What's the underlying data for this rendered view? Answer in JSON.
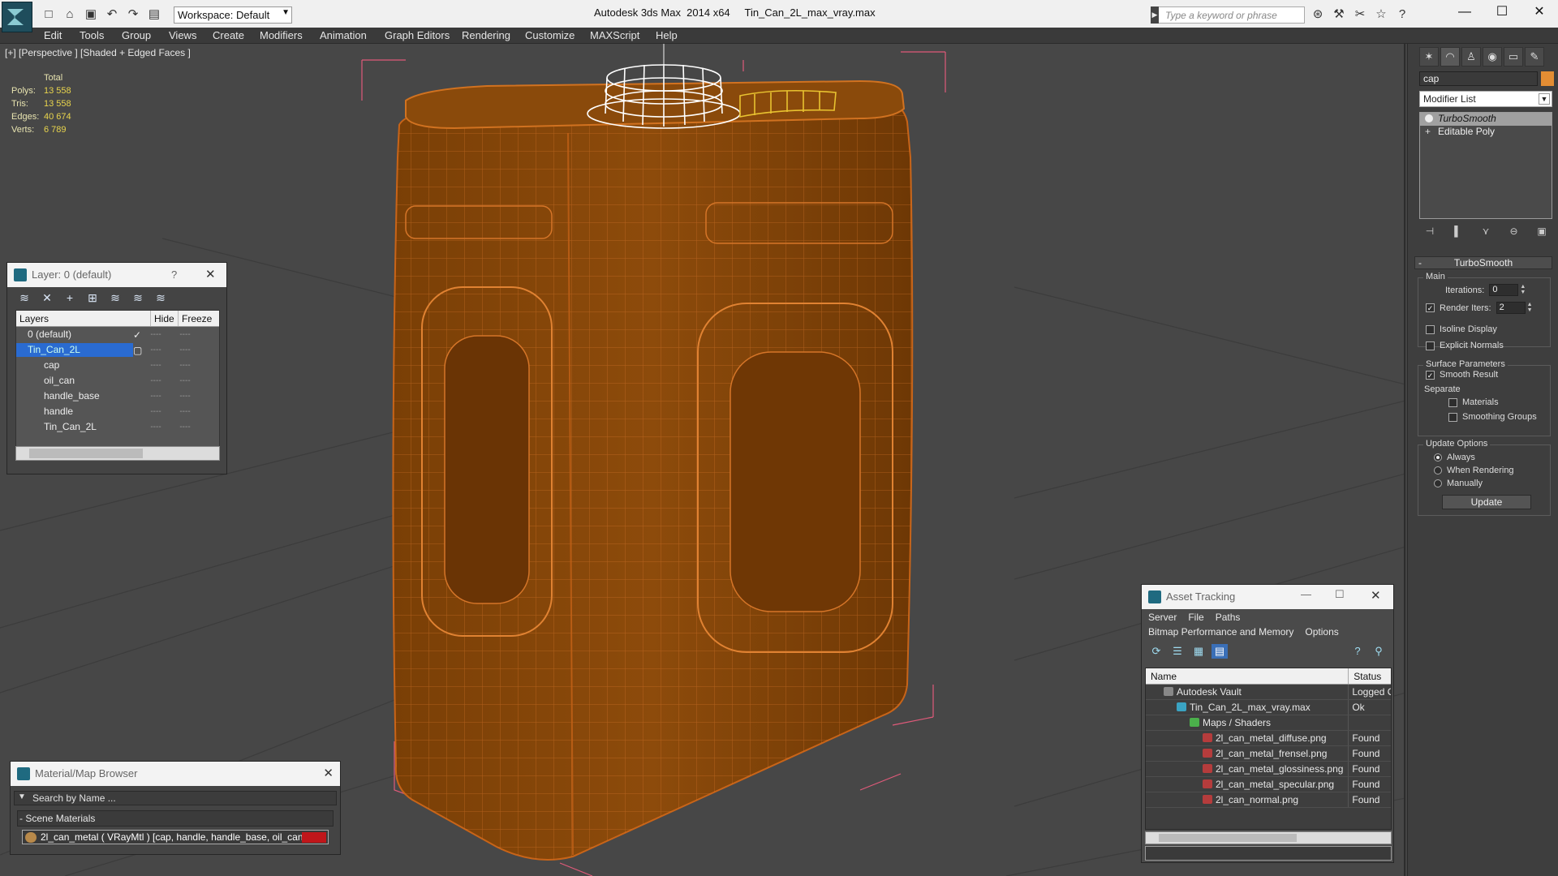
{
  "app": {
    "title": "Autodesk 3ds Max  2014 x64     Tin_Can_2L_max_vray.max",
    "workspace": "Workspace: Default",
    "search_placeholder": "Type a keyword or phrase"
  },
  "menu": [
    "Edit",
    "Tools",
    "Group",
    "Views",
    "Create",
    "Modifiers",
    "Animation",
    "Graph Editors",
    "Rendering",
    "Customize",
    "MAXScript",
    "Help"
  ],
  "viewport": {
    "label": "[+] [Perspective ] [Shaded + Edged Faces ]",
    "stats": {
      "total_label": "Total",
      "rows": [
        {
          "k": "Polys:",
          "v": "13 558"
        },
        {
          "k": "Tris:",
          "v": "13 558"
        },
        {
          "k": "Edges:",
          "v": "40 674"
        },
        {
          "k": "Verts:",
          "v": "6 789"
        }
      ]
    }
  },
  "layers_window": {
    "title": "Layer: 0 (default)",
    "help": "?",
    "columns": {
      "layers": "Layers",
      "hide": "Hide",
      "freeze": "Freeze"
    },
    "rows": [
      {
        "name": "0 (default)",
        "check": "✓"
      },
      {
        "name": "Tin_Can_2L",
        "check": ""
      },
      {
        "name": "cap",
        "check": ""
      },
      {
        "name": "oil_can",
        "check": ""
      },
      {
        "name": "handle_base",
        "check": ""
      },
      {
        "name": "handle",
        "check": ""
      },
      {
        "name": "Tin_Can_2L",
        "check": ""
      }
    ],
    "dash": "----"
  },
  "material_browser": {
    "title": "Material/Map Browser",
    "search_placeholder": "Search by Name ...",
    "group": "Scene Materials",
    "material": "2l_can_metal  ( VRayMtl ) [cap, handle, handle_base, oil_can]"
  },
  "asset_tracking": {
    "title": "Asset Tracking",
    "menu1": [
      "Server",
      "File",
      "Paths"
    ],
    "menu2": [
      "Bitmap Performance and Memory",
      "Options"
    ],
    "columns": {
      "name": "Name",
      "status": "Status"
    },
    "rows": [
      {
        "name": "Autodesk Vault",
        "status": "Logged O",
        "indent": 1
      },
      {
        "name": "Tin_Can_2L_max_vray.max",
        "status": "Ok",
        "indent": 2
      },
      {
        "name": "Maps / Shaders",
        "status": "",
        "indent": 3
      },
      {
        "name": "2l_can_metal_diffuse.png",
        "status": "Found",
        "indent": 4
      },
      {
        "name": "2l_can_metal_frensel.png",
        "status": "Found",
        "indent": 4
      },
      {
        "name": "2l_can_metal_glossiness.png",
        "status": "Found",
        "indent": 4
      },
      {
        "name": "2l_can_metal_specular.png",
        "status": "Found",
        "indent": 4
      },
      {
        "name": "2l_can_normal.png",
        "status": "Found",
        "indent": 4
      }
    ]
  },
  "command_panel": {
    "object_name": "cap",
    "object_color": "#e38d33",
    "modifier_list": "Modifier List",
    "stack": [
      "TurboSmooth",
      "Editable Poly"
    ],
    "rollout": "TurboSmooth",
    "main_group": "Main",
    "iterations_label": "Iterations:",
    "iterations": "0",
    "render_iters_label": "Render Iters:",
    "render_iters": "2",
    "isoline": "Isoline Display",
    "explicit_normals": "Explicit Normals",
    "surface_group": "Surface Parameters",
    "smooth_result": "Smooth Result",
    "separate": "Separate",
    "materials": "Materials",
    "smoothing_groups": "Smoothing Groups",
    "update_group": "Update Options",
    "always": "Always",
    "when_rendering": "When Rendering",
    "manually": "Manually",
    "update_button": "Update"
  }
}
